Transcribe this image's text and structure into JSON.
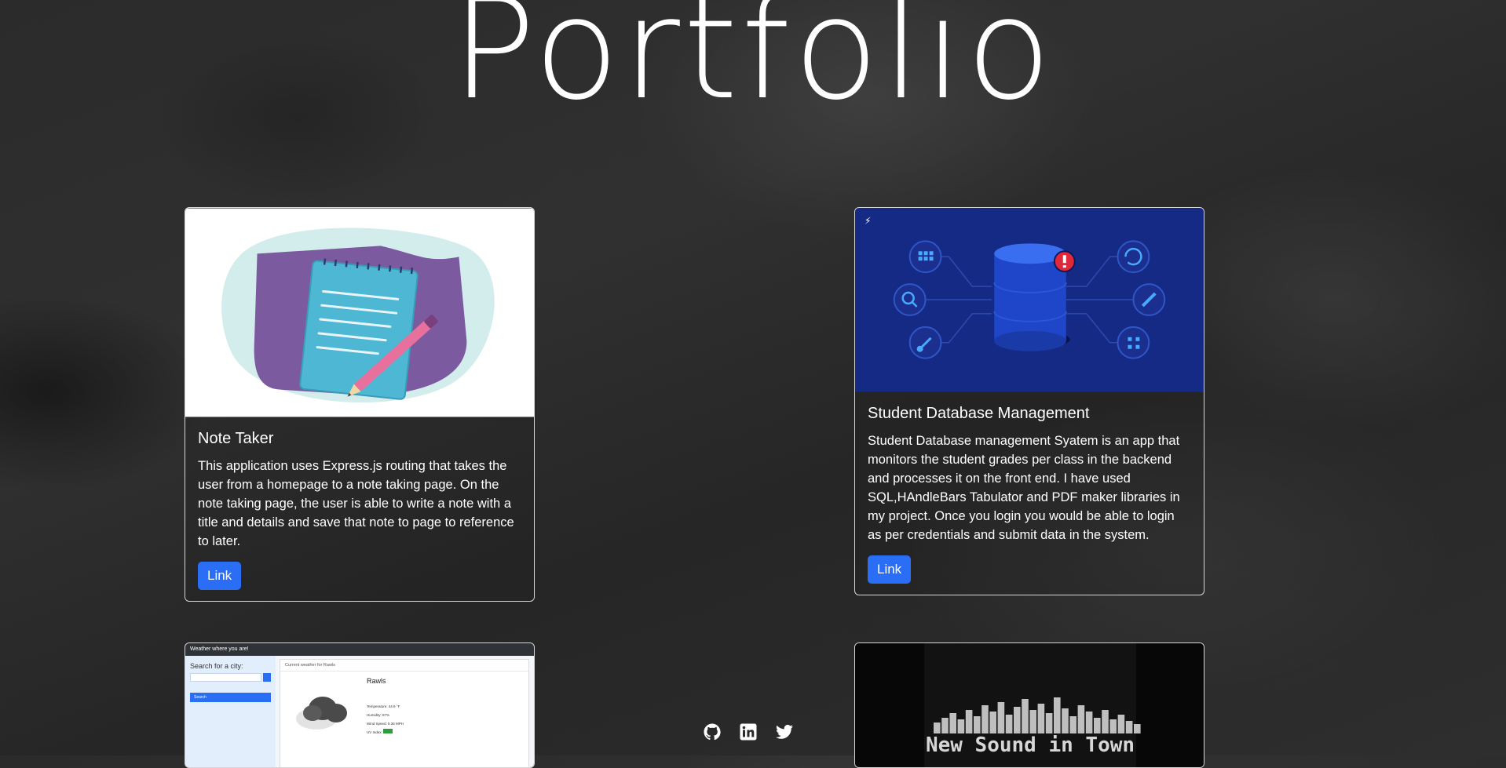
{
  "page": {
    "title": "Portfolio"
  },
  "projects": [
    {
      "title": "Note Taker",
      "description": "This application uses Express.js routing that takes the user from a homepage to a note taking page. On the note taking page, the user is able to write a note with a title and details and save that note to page to reference to later.",
      "link_label": "Link"
    },
    {
      "title": "Student Database Management",
      "description": "Student Database management Syatem is an app that monitors the student grades per class in the backend and processes it on the front end. I have used SQL,HAndleBars Tabulator and PDF maker libraries in my project. Once you login you would be able to login as per credentials and submit data in the system.",
      "link_label": "Link"
    },
    {
      "weather_preview": {
        "window_title": "Weather where you are!",
        "search_label": "Search for a city:",
        "search_button": "Search",
        "panel_title": "Current weather for Rawls",
        "city": "Rawls",
        "lines": [
          "Temperature: 44.9 °F",
          "Humidity: 87%",
          "Wind Speed: 5.36 MPH",
          "UV Index:"
        ]
      }
    },
    {
      "banner_text": "New Sound in Town"
    }
  ],
  "social": {
    "icons": [
      "github-icon",
      "linkedin-icon",
      "twitter-icon"
    ]
  }
}
